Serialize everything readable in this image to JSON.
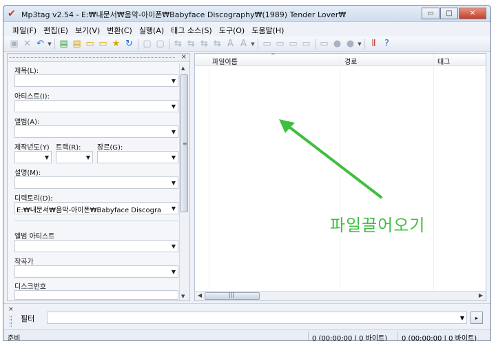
{
  "window": {
    "title": "Mp3tag v2.54  -  E:₩내문서₩음악-아이폰₩Babyface Discography₩(1989) Tender Lover₩",
    "app_icon": "checkmark-icon",
    "controls": {
      "minimize": "▭",
      "maximize": "□",
      "close": "✕"
    }
  },
  "menu": [
    "파일(F)",
    "편집(E)",
    "보기(V)",
    "변환(C)",
    "실행(A)",
    "태그 소스(S)",
    "도구(O)",
    "도움말(H)"
  ],
  "toolbar": {
    "icons": [
      "save-icon",
      "remove-tag-icon",
      "undo-icon",
      "change-directory-icon",
      "add-directory-icon",
      "folder-icon",
      "folder-sub-icon",
      "favorite-icon",
      "refresh-icon",
      "copy-tag-icon",
      "paste-tag-icon",
      "tag-filename-icon",
      "filename-tag-icon",
      "filename-filename-icon",
      "text-tag-icon",
      "auto-numbering-icon",
      "actions-icon",
      "export-icon",
      "playlist-icon",
      "case-conversion-icon",
      "tag-sources-icon",
      "freedb-icon",
      "options-icon",
      "help-icon"
    ]
  },
  "tag_panel": {
    "close": "×",
    "fields": {
      "title": {
        "label": "제목(L):",
        "value": ""
      },
      "artist": {
        "label": "아티스트(I):",
        "value": ""
      },
      "album": {
        "label": "앨범(A):",
        "value": ""
      },
      "year": {
        "label": "제작년도(Y)",
        "value": ""
      },
      "track": {
        "label": "트랙(R):",
        "value": ""
      },
      "genre": {
        "label": "장르(G):",
        "value": ""
      },
      "comment": {
        "label": "설명(M):",
        "value": ""
      },
      "directory": {
        "label": "디렉토리(D):",
        "value": "E:₩내문서₩음악-아이폰₩Babyface Discogra"
      },
      "album_artist": {
        "label": "앨범 아티스트",
        "value": ""
      },
      "composer": {
        "label": "작곡가",
        "value": ""
      },
      "discnumber": {
        "label": "디스크번호",
        "value": ""
      }
    }
  },
  "file_list": {
    "columns": [
      "파일이름",
      "경로",
      "태그"
    ],
    "sort_indicator": "^",
    "annotation": "파일끌어오기",
    "annotation_color": "#3fbf3f",
    "scroll_grip": "|||"
  },
  "filter_bar": {
    "close": "×",
    "label": "필터",
    "value": "",
    "go": "▸"
  },
  "status": {
    "ready": "준비",
    "selected": "0 (00:00:00 | 0 바이트)",
    "total": "0 (00:00:00 | 0 바이트)"
  }
}
